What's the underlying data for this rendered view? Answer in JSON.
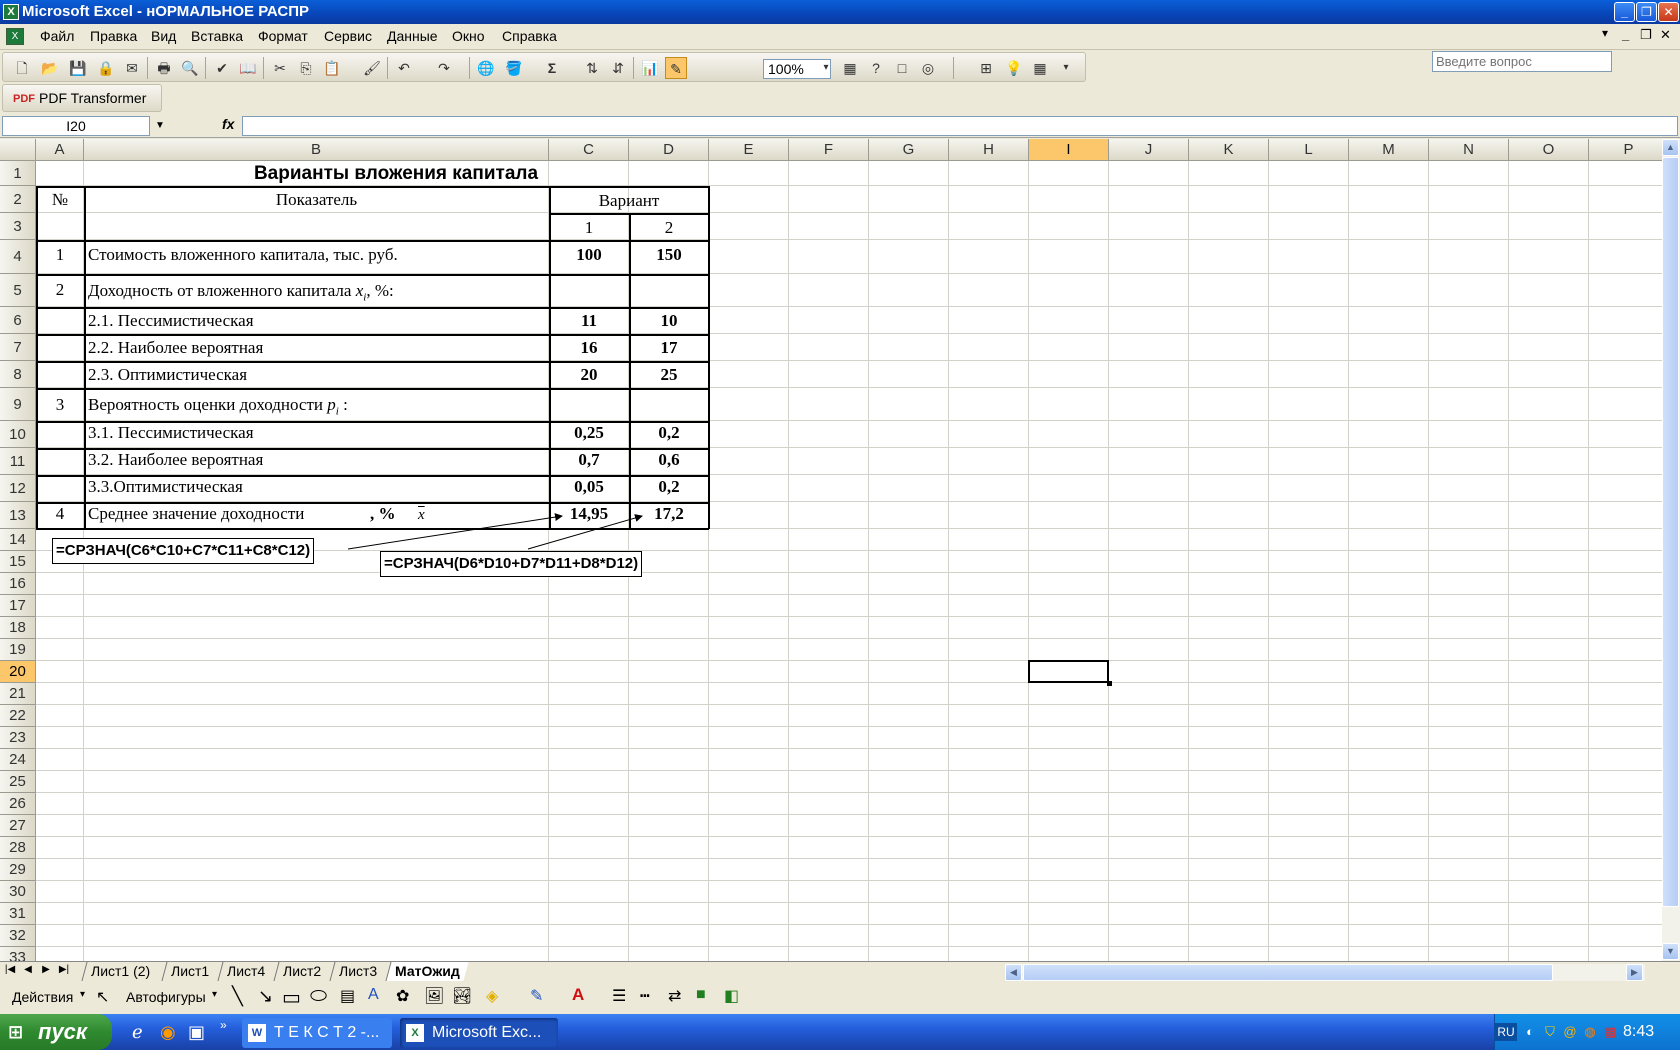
{
  "window": {
    "title": "Microsoft Excel - нОРМАЛЬНОЕ РАСПР"
  },
  "menu": [
    "Файл",
    "Правка",
    "Вид",
    "Вставка",
    "Формат",
    "Сервис",
    "Данные",
    "Окно",
    "Справка"
  ],
  "help": {
    "placeholder": "Введите вопрос"
  },
  "toolbar": {
    "zoom": "100%",
    "pdf_label": "PDF Transformer"
  },
  "formula_bar": {
    "name_box": "I20",
    "fx_label": "fx",
    "formula": ""
  },
  "columns": [
    "A",
    "B",
    "C",
    "D",
    "E",
    "F",
    "G",
    "H",
    "I",
    "J",
    "K",
    "L",
    "M",
    "N",
    "O",
    "P"
  ],
  "rows": [
    "1",
    "2",
    "3",
    "4",
    "5",
    "6",
    "7",
    "8",
    "9",
    "10",
    "11",
    "12",
    "13",
    "14",
    "15",
    "16",
    "17",
    "18",
    "19",
    "20",
    "21",
    "22",
    "23",
    "24",
    "25",
    "26",
    "27",
    "28",
    "29",
    "30",
    "31",
    "32",
    "33"
  ],
  "sheet": {
    "title": "Варианты вложения капитала",
    "hdr_no": "№",
    "hdr_indicator": "Показатель",
    "hdr_variant": "Вариант",
    "hdr_v1": "1",
    "hdr_v2": "2",
    "r4": {
      "n": "1",
      "label": "Стоимость вложенного капитала, тыс. руб.",
      "c": "100",
      "d": "150"
    },
    "r5": {
      "n": "2",
      "label": "Доходность от вложенного капитала",
      "var": "x",
      "sub": "i",
      "suffix": ", %:"
    },
    "r6": {
      "label": "2.1. Пессимистическая",
      "c": "11",
      "d": "10"
    },
    "r7": {
      "label": "2.2. Наиболее вероятная",
      "c": "16",
      "d": "17"
    },
    "r8": {
      "label": "2.3. Оптимистическая",
      "c": "20",
      "d": "25"
    },
    "r9": {
      "n": "3",
      "label": "Вероятность оценки доходности",
      "var": "p",
      "sub": "i",
      "suffix": " :"
    },
    "r10": {
      "label": "3.1. Пессимистическая",
      "c": "0,25",
      "d": "0,2"
    },
    "r11": {
      "label": "3.2. Наиболее вероятная",
      "c": "0,7",
      "d": "0,6"
    },
    "r12": {
      "label": "3.3.Оптимистическая",
      "c": "0,05",
      "d": "0,2"
    },
    "r13": {
      "n": "4",
      "label": "Среднее значение доходности",
      "unit": ", %",
      "xbar": "x",
      "c": "14,95",
      "d": "17,2"
    }
  },
  "callouts": {
    "c": "=СРЗНАЧ(C6*C10+C7*C11+C8*C12)",
    "d": "=СРЗНАЧ(D6*D10+D7*D11+D8*D12)"
  },
  "tabs": [
    "Лист1 (2)",
    "Лист1",
    "Лист4",
    "Лист2",
    "Лист3",
    "МатОжид"
  ],
  "active_tab": "МатОжид",
  "drawing": {
    "actions": "Действия",
    "autoshapes": "Автофигуры"
  },
  "taskbar": {
    "start": "пуск",
    "tasks": [
      "Т Е К С Т 2 -...",
      "Microsoft Exc..."
    ],
    "lang": "RU",
    "clock": "8:43"
  },
  "colors": {
    "title_bar": "#0a5fd8",
    "selected_header": "#fbc76a",
    "taskbar": "#245edb",
    "start": "#2f8a2f"
  }
}
